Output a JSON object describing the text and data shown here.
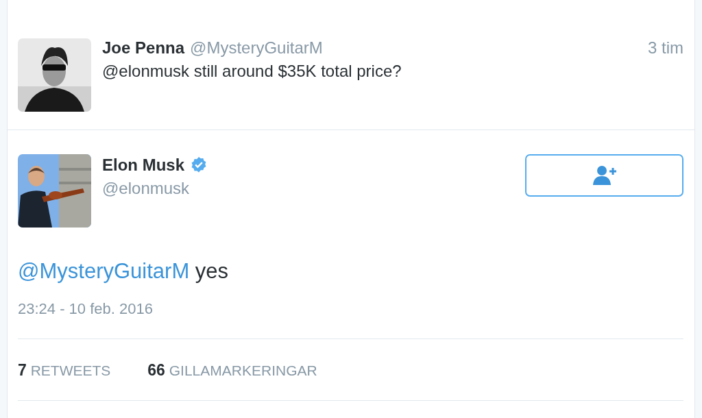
{
  "parent_tweet": {
    "name": "Joe Penna",
    "handle": "@MysteryGuitarM",
    "time": "3 tim",
    "text": "@elonmusk still around $35K total price?"
  },
  "tweet": {
    "name": "Elon Musk",
    "verified": true,
    "handle": "@elonmusk",
    "mention": "@MysteryGuitarM",
    "text": "yes",
    "timestamp": "23:24 - 10 feb. 2016"
  },
  "stats": [
    {
      "count": "7",
      "label": "RETWEETS"
    },
    {
      "count": "66",
      "label": "GILLAMARKERINGAR"
    }
  ]
}
